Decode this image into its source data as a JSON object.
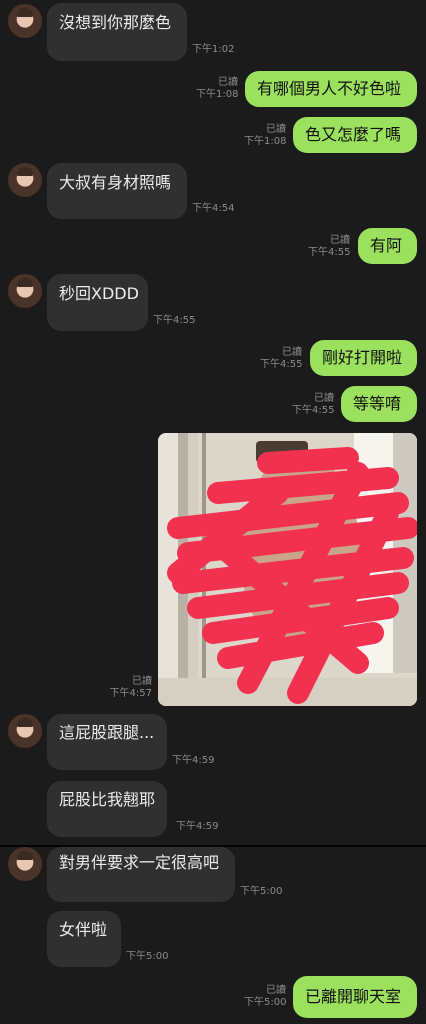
{
  "messages": [
    {
      "side": "in",
      "text": "沒想到你那麼色",
      "time": "下午1:02"
    },
    {
      "side": "out",
      "text": "有哪個男人不好色啦",
      "read": "已讀",
      "time": "下午1:08"
    },
    {
      "side": "out",
      "text": "色又怎麼了嗎",
      "read": "已讀",
      "time": "下午1:08"
    },
    {
      "side": "in",
      "text": "大叔有身材照嗎",
      "time": "下午4:54"
    },
    {
      "side": "out",
      "text": "有阿",
      "read": "已讀",
      "time": "下午4:55"
    },
    {
      "side": "in",
      "text": "秒回XDDD",
      "time": "下午4:55"
    },
    {
      "side": "out",
      "text": "剛好打開啦",
      "read": "已讀",
      "time": "下午4:55"
    },
    {
      "side": "out",
      "text": "等等唷",
      "read": "已讀",
      "time": "下午4:55"
    },
    {
      "side": "out",
      "type": "photo",
      "read": "已讀",
      "time": "下午4:57"
    },
    {
      "side": "in",
      "text": "這屁股跟腿...",
      "time": "下午4:59"
    },
    {
      "side": "in",
      "text": "屁股比我翹耶",
      "time": "下午4:59"
    },
    {
      "side": "in",
      "text": "對男伴要求一定很高吧",
      "time": "下午5:00"
    },
    {
      "side": "in",
      "text": "女伴啦",
      "time": "下午5:00"
    },
    {
      "side": "out",
      "text": "已離開聊天室",
      "read": "已讀",
      "time": "下午5:00"
    }
  ],
  "colors": {
    "background": "#1b1b1b",
    "incoming_bubble": "#303030",
    "outgoing_bubble": "#9be15d",
    "redaction": "#f2314f"
  }
}
